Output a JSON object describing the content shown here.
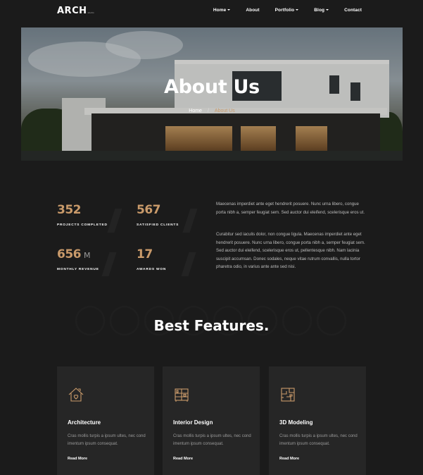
{
  "header": {
    "logo": "ARCH",
    "logo_sub": "studio",
    "nav": [
      {
        "label": "Home",
        "dropdown": true
      },
      {
        "label": "About",
        "dropdown": false
      },
      {
        "label": "Portfolio",
        "dropdown": true
      },
      {
        "label": "Blog",
        "dropdown": true
      },
      {
        "label": "Contact",
        "dropdown": false
      }
    ]
  },
  "hero": {
    "title": "About Us",
    "breadcrumb_home": "Home",
    "breadcrumb_sep": "/",
    "breadcrumb_current": "About Us"
  },
  "stats": [
    {
      "value": "352",
      "unit": "",
      "label": "PROJECTS COMPLETED"
    },
    {
      "value": "567",
      "unit": "",
      "label": "SATISFIED CLIENTS"
    },
    {
      "value": "656",
      "unit": "M",
      "label": "MONTHLY REVENUE"
    },
    {
      "value": "17",
      "unit": "",
      "label": "AWARDS WON"
    }
  ],
  "about": {
    "p1": "Maecenas imperdiet ante eget hendrerit posuere. Nunc urna libero, congue porta nibh a, semper feugiat sem. Sed auctor dui eleifend, scelerisque eros ut.",
    "p2": "Curabitur sed iaculis dolor, non congue ligula. Maecenas imperdiet ante eget hendrerit posuere. Nunc urna libero, congue porta nibh a, semper feugiat sem. Sed auctor dui eleifend, scelerisque eros ut, pellentesque nibh. Nam lacinia suscipit accumsan. Donec sodales, neque vitae rutrum convallis, nulla tortor pharetra odio, in varius ante ante sed nisi."
  },
  "features": {
    "title": "Best Features.",
    "cards": [
      {
        "icon": "house-heart-icon",
        "title": "Architecture",
        "text": "Cras mollis turpis a ipsum ultes, nec cond imentum ipsum consequat.",
        "link": "Read More"
      },
      {
        "icon": "interior-shelf-icon",
        "title": "Interior Design",
        "text": "Cras mollis turpis a ipsum ultes, nec cond imentum ipsum consequat.",
        "link": "Read More"
      },
      {
        "icon": "floor-plan-icon",
        "title": "3D Modeling",
        "text": "Cras mollis turpis a ipsum ultes, nec cond imentum ipsum consequat.",
        "link": "Read More"
      }
    ]
  },
  "colors": {
    "background": "#1b1b1b",
    "accent": "#c99a6a",
    "card": "#262626"
  }
}
